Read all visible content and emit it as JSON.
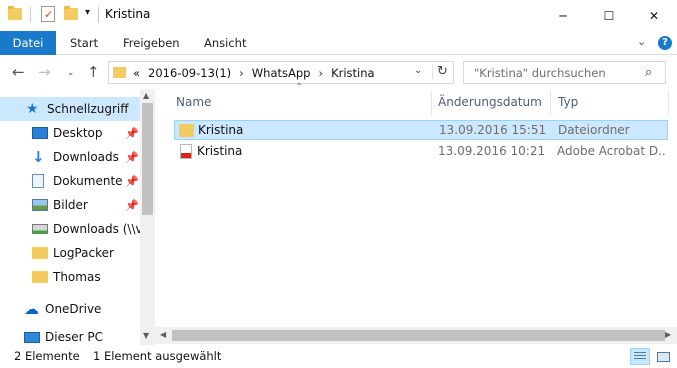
{
  "window": {
    "title": "Kristina",
    "minimize_glyph": "─",
    "maximize_glyph": "☐",
    "close_glyph": "✕"
  },
  "ribbon": {
    "tabs": [
      {
        "label": "Datei"
      },
      {
        "label": "Start"
      },
      {
        "label": "Freigeben"
      },
      {
        "label": "Ansicht"
      }
    ],
    "help_label": "?",
    "accent": "#1979ca"
  },
  "address": {
    "overflow": "«",
    "crumbs": [
      "2016-09-13(1)",
      "WhatsApp",
      "Kristina"
    ],
    "separator": "›"
  },
  "search": {
    "placeholder": "\"Kristina\" durchsuchen"
  },
  "nav_pane": {
    "items": [
      {
        "label": "Schnellzugriff",
        "icon": "star-icon"
      },
      {
        "label": "Desktop",
        "icon": "desktop-icon",
        "pinned": true
      },
      {
        "label": "Downloads",
        "icon": "download-arrow-icon",
        "pinned": true
      },
      {
        "label": "Dokumente",
        "icon": "document-icon",
        "pinned": true
      },
      {
        "label": "Bilder",
        "icon": "pictures-icon",
        "pinned": true
      },
      {
        "label": "Downloads (\\\\vb",
        "icon": "network-drive-icon"
      },
      {
        "label": "LogPacker",
        "icon": "folder-icon"
      },
      {
        "label": "Thomas",
        "icon": "folder-icon"
      },
      {
        "label": "OneDrive",
        "icon": "cloud-icon"
      },
      {
        "label": "Dieser PC",
        "icon": "computer-icon"
      }
    ]
  },
  "columns": {
    "name": "Name",
    "date": "Änderungsdatum",
    "type": "Typ"
  },
  "files": [
    {
      "name": "Kristina",
      "date": "13.09.2016 15:51",
      "type": "Dateiordner",
      "icon": "folder-icon",
      "selected": true
    },
    {
      "name": "Kristina",
      "date": "13.09.2016 10:21",
      "type": "Adobe Acrobat D...",
      "icon": "pdf-icon",
      "selected": false
    }
  ],
  "status": {
    "count": "2 Elemente",
    "selection": "1 Element ausgewählt"
  },
  "colors": {
    "selection": "#cce8ff",
    "selection_border": "#99d1ff",
    "folder": "#f4cb5f"
  }
}
